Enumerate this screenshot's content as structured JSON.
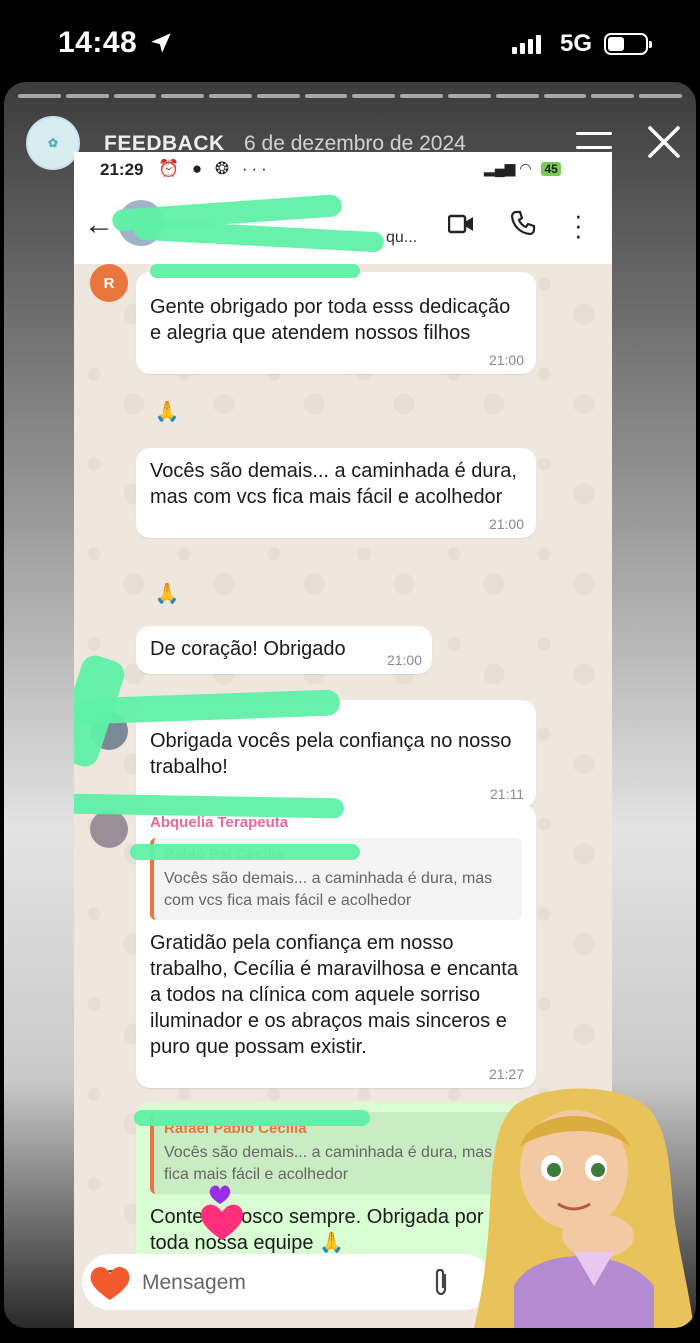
{
  "ios_status": {
    "time": "14:48",
    "network": "5G"
  },
  "story": {
    "account_name": "FEEDBACK",
    "date": "6 de dezembro de 2024"
  },
  "android_status": {
    "time": "21:29",
    "battery": "45"
  },
  "chat_header": {
    "subtitle": "qu..."
  },
  "messages": [
    {
      "text": "Gente obrigado por toda esss dedicação e alegria que atendem nossos filhos",
      "time": "21:00",
      "reaction": "🙏"
    },
    {
      "text": "Vocês são demais... a caminhada é dura, mas com vcs fica mais fácil e acolhedor",
      "time": "21:00",
      "reaction": "🙏"
    },
    {
      "text": "De coração! Obrigado",
      "time": "21:00"
    },
    {
      "text": "Obrigada vocês pela confiança no nosso trabalho!",
      "time": "21:11"
    },
    {
      "sender": "Abquelia Terapeuta",
      "quote_name": "Pablo Pai Cecília",
      "quote_text": "Vocês são demais... a caminhada é dura, mas com vcs fica mais fácil e acolhedor",
      "text": "Gratidão pela confiança em nosso trabalho, Cecília é maravilhosa e encanta a todos na clínica com aquele sorriso iluminador e os abraços mais sinceros e puro que possam existir.",
      "time": "21:27"
    },
    {
      "quote_name": "Rafael Pablo Cecília",
      "quote_text": "Vocês são demais... a caminhada é dura, mas com vcs fica mais fácil e acolhedor",
      "text": "Conte conosco sempre. Obrigada por confiar em toda nossa equipe 🙏"
    }
  ],
  "input": {
    "placeholder": "Mensagem"
  },
  "colors": {
    "whatsapp_bg": "#efe7de",
    "outgoing_bubble": "#d9fdd3",
    "scribble": "#5ff0a6",
    "sender_pink": "#e46a9b"
  }
}
